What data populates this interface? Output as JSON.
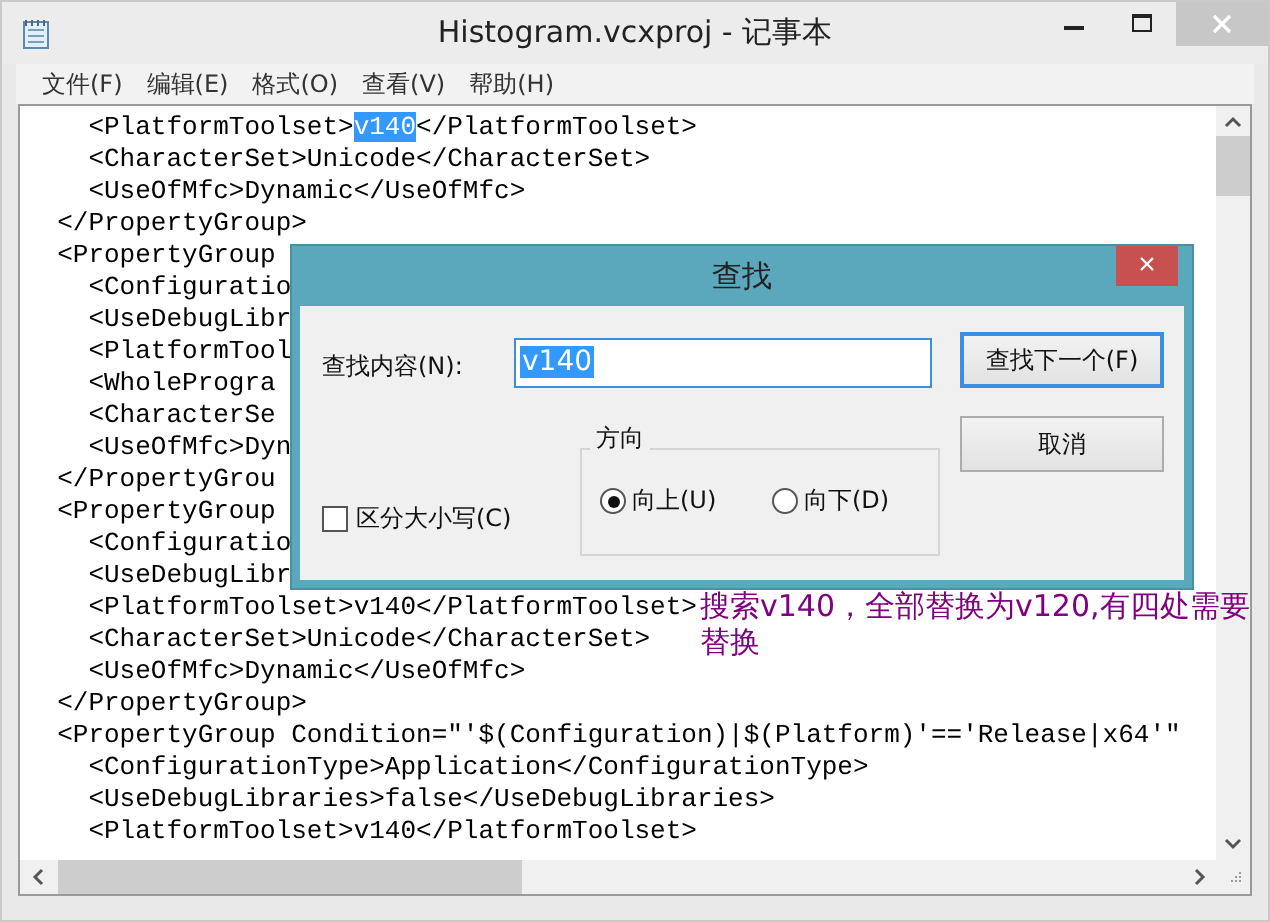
{
  "window": {
    "title": "Histogram.vcxproj - 记事本"
  },
  "menu": [
    "文件(F)",
    "编辑(E)",
    "格式(O)",
    "查看(V)",
    "帮助(H)"
  ],
  "editor": {
    "lines": [
      {
        "text": "    <PlatformToolset>",
        "selection": "v140",
        "after": "</PlatformToolset>"
      },
      {
        "text": "    <CharacterSet>Unicode</CharacterSet>"
      },
      {
        "text": "    <UseOfMfc>Dynamic</UseOfMfc>"
      },
      {
        "text": "  </PropertyGroup>"
      },
      {
        "text": "  <PropertyGroup "
      },
      {
        "text": "    <Configuratio"
      },
      {
        "text": "    <UseDebugLibr"
      },
      {
        "text": "    <PlatformTool"
      },
      {
        "text": "    <WholeProgra"
      },
      {
        "text": "    <CharacterSe"
      },
      {
        "text": "    <UseOfMfc>Dyn"
      },
      {
        "text": "  </PropertyGrou"
      },
      {
        "text": "  <PropertyGroup "
      },
      {
        "text": "    <Configuratio"
      },
      {
        "text": "    <UseDebugLibr"
      },
      {
        "text": "    <PlatformToolset>v140</PlatformToolset>"
      },
      {
        "text": "    <CharacterSet>Unicode</CharacterSet>"
      },
      {
        "text": "    <UseOfMfc>Dynamic</UseOfMfc>"
      },
      {
        "text": "  </PropertyGroup>"
      },
      {
        "text": "  <PropertyGroup Condition=\"'$(Configuration)|$(Platform)'=='Release|x64'\""
      },
      {
        "text": "    <ConfigurationType>Application</ConfigurationType>"
      },
      {
        "text": "    <UseDebugLibraries>false</UseDebugLibraries>"
      },
      {
        "text": "    <PlatformToolset>v140</PlatformToolset>"
      }
    ],
    "annotation": "搜索v140，全部替换为v120,有四处需要替换"
  },
  "dialog": {
    "title": "查找",
    "close": "×",
    "find_label": "查找内容(N):",
    "find_value": "v140",
    "find_next": "查找下一个(F)",
    "cancel": "取消",
    "match_case": {
      "label": "区分大小写(C)",
      "checked": false
    },
    "direction": {
      "title": "方向",
      "options": [
        {
          "label": "向上(U)",
          "selected": true
        },
        {
          "label": "向下(D)",
          "selected": false
        }
      ]
    }
  }
}
